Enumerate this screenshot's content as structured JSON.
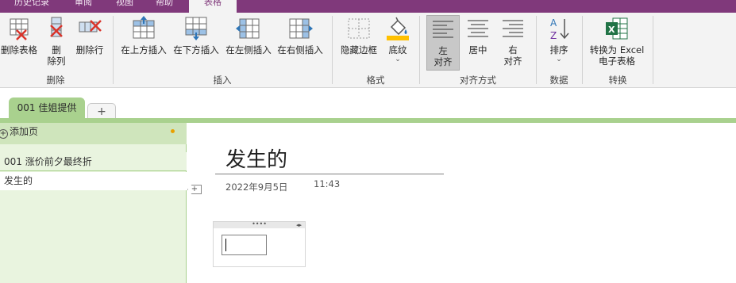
{
  "tabs": {
    "history": "历史记录",
    "review": "审阅",
    "view": "视图",
    "help": "帮助",
    "table": "表格"
  },
  "ribbon": {
    "delete_group": {
      "label": "删除",
      "delete_table": "删除表格",
      "delete_column_l1": "删",
      "delete_column_l2": "除列",
      "delete_row": "删除行"
    },
    "insert_group": {
      "label": "插入",
      "insert_above": "在上方插入",
      "insert_below": "在下方插入",
      "insert_left": "在左侧插入",
      "insert_right": "在右侧插入"
    },
    "format_group": {
      "label": "格式",
      "hide_borders": "隐藏边框",
      "shading": "底纹"
    },
    "align_group": {
      "label": "对齐方式",
      "align_left_l1": "左",
      "align_left_l2": "对齐",
      "center": "居中",
      "align_right_l1": "右",
      "align_right_l2": "对齐"
    },
    "data_group": {
      "label": "数据",
      "sort": "排序"
    },
    "convert_group": {
      "label": "转换",
      "to_excel_l1": "转换为 Excel",
      "to_excel_l2": "电子表格"
    }
  },
  "section": {
    "active_tab": "001 佳姐提供",
    "add_tab": "+"
  },
  "pages": {
    "add_page": "添加页",
    "items": [
      "001 涨价前夕最终折",
      "发生的"
    ]
  },
  "note": {
    "title": "发生的",
    "date": "2022年9月5日",
    "time": "11:43"
  },
  "colors": {
    "accent": "#80397b",
    "section": "#a9d18e"
  }
}
